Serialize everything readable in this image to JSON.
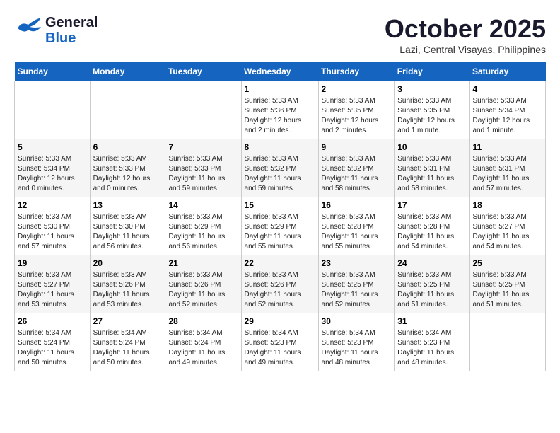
{
  "header": {
    "logo": {
      "line1": "General",
      "line2": "Blue"
    },
    "title": "October 2025",
    "location": "Lazi, Central Visayas, Philippines"
  },
  "days_of_week": [
    "Sunday",
    "Monday",
    "Tuesday",
    "Wednesday",
    "Thursday",
    "Friday",
    "Saturday"
  ],
  "weeks": [
    [
      {
        "day": "",
        "info": ""
      },
      {
        "day": "",
        "info": ""
      },
      {
        "day": "",
        "info": ""
      },
      {
        "day": "1",
        "info": "Sunrise: 5:33 AM\nSunset: 5:36 PM\nDaylight: 12 hours\nand 2 minutes."
      },
      {
        "day": "2",
        "info": "Sunrise: 5:33 AM\nSunset: 5:35 PM\nDaylight: 12 hours\nand 2 minutes."
      },
      {
        "day": "3",
        "info": "Sunrise: 5:33 AM\nSunset: 5:35 PM\nDaylight: 12 hours\nand 1 minute."
      },
      {
        "day": "4",
        "info": "Sunrise: 5:33 AM\nSunset: 5:34 PM\nDaylight: 12 hours\nand 1 minute."
      }
    ],
    [
      {
        "day": "5",
        "info": "Sunrise: 5:33 AM\nSunset: 5:34 PM\nDaylight: 12 hours\nand 0 minutes."
      },
      {
        "day": "6",
        "info": "Sunrise: 5:33 AM\nSunset: 5:33 PM\nDaylight: 12 hours\nand 0 minutes."
      },
      {
        "day": "7",
        "info": "Sunrise: 5:33 AM\nSunset: 5:33 PM\nDaylight: 11 hours\nand 59 minutes."
      },
      {
        "day": "8",
        "info": "Sunrise: 5:33 AM\nSunset: 5:32 PM\nDaylight: 11 hours\nand 59 minutes."
      },
      {
        "day": "9",
        "info": "Sunrise: 5:33 AM\nSunset: 5:32 PM\nDaylight: 11 hours\nand 58 minutes."
      },
      {
        "day": "10",
        "info": "Sunrise: 5:33 AM\nSunset: 5:31 PM\nDaylight: 11 hours\nand 58 minutes."
      },
      {
        "day": "11",
        "info": "Sunrise: 5:33 AM\nSunset: 5:31 PM\nDaylight: 11 hours\nand 57 minutes."
      }
    ],
    [
      {
        "day": "12",
        "info": "Sunrise: 5:33 AM\nSunset: 5:30 PM\nDaylight: 11 hours\nand 57 minutes."
      },
      {
        "day": "13",
        "info": "Sunrise: 5:33 AM\nSunset: 5:30 PM\nDaylight: 11 hours\nand 56 minutes."
      },
      {
        "day": "14",
        "info": "Sunrise: 5:33 AM\nSunset: 5:29 PM\nDaylight: 11 hours\nand 56 minutes."
      },
      {
        "day": "15",
        "info": "Sunrise: 5:33 AM\nSunset: 5:29 PM\nDaylight: 11 hours\nand 55 minutes."
      },
      {
        "day": "16",
        "info": "Sunrise: 5:33 AM\nSunset: 5:28 PM\nDaylight: 11 hours\nand 55 minutes."
      },
      {
        "day": "17",
        "info": "Sunrise: 5:33 AM\nSunset: 5:28 PM\nDaylight: 11 hours\nand 54 minutes."
      },
      {
        "day": "18",
        "info": "Sunrise: 5:33 AM\nSunset: 5:27 PM\nDaylight: 11 hours\nand 54 minutes."
      }
    ],
    [
      {
        "day": "19",
        "info": "Sunrise: 5:33 AM\nSunset: 5:27 PM\nDaylight: 11 hours\nand 53 minutes."
      },
      {
        "day": "20",
        "info": "Sunrise: 5:33 AM\nSunset: 5:26 PM\nDaylight: 11 hours\nand 53 minutes."
      },
      {
        "day": "21",
        "info": "Sunrise: 5:33 AM\nSunset: 5:26 PM\nDaylight: 11 hours\nand 52 minutes."
      },
      {
        "day": "22",
        "info": "Sunrise: 5:33 AM\nSunset: 5:26 PM\nDaylight: 11 hours\nand 52 minutes."
      },
      {
        "day": "23",
        "info": "Sunrise: 5:33 AM\nSunset: 5:25 PM\nDaylight: 11 hours\nand 52 minutes."
      },
      {
        "day": "24",
        "info": "Sunrise: 5:33 AM\nSunset: 5:25 PM\nDaylight: 11 hours\nand 51 minutes."
      },
      {
        "day": "25",
        "info": "Sunrise: 5:33 AM\nSunset: 5:25 PM\nDaylight: 11 hours\nand 51 minutes."
      }
    ],
    [
      {
        "day": "26",
        "info": "Sunrise: 5:34 AM\nSunset: 5:24 PM\nDaylight: 11 hours\nand 50 minutes."
      },
      {
        "day": "27",
        "info": "Sunrise: 5:34 AM\nSunset: 5:24 PM\nDaylight: 11 hours\nand 50 minutes."
      },
      {
        "day": "28",
        "info": "Sunrise: 5:34 AM\nSunset: 5:24 PM\nDaylight: 11 hours\nand 49 minutes."
      },
      {
        "day": "29",
        "info": "Sunrise: 5:34 AM\nSunset: 5:23 PM\nDaylight: 11 hours\nand 49 minutes."
      },
      {
        "day": "30",
        "info": "Sunrise: 5:34 AM\nSunset: 5:23 PM\nDaylight: 11 hours\nand 48 minutes."
      },
      {
        "day": "31",
        "info": "Sunrise: 5:34 AM\nSunset: 5:23 PM\nDaylight: 11 hours\nand 48 minutes."
      },
      {
        "day": "",
        "info": ""
      }
    ]
  ]
}
